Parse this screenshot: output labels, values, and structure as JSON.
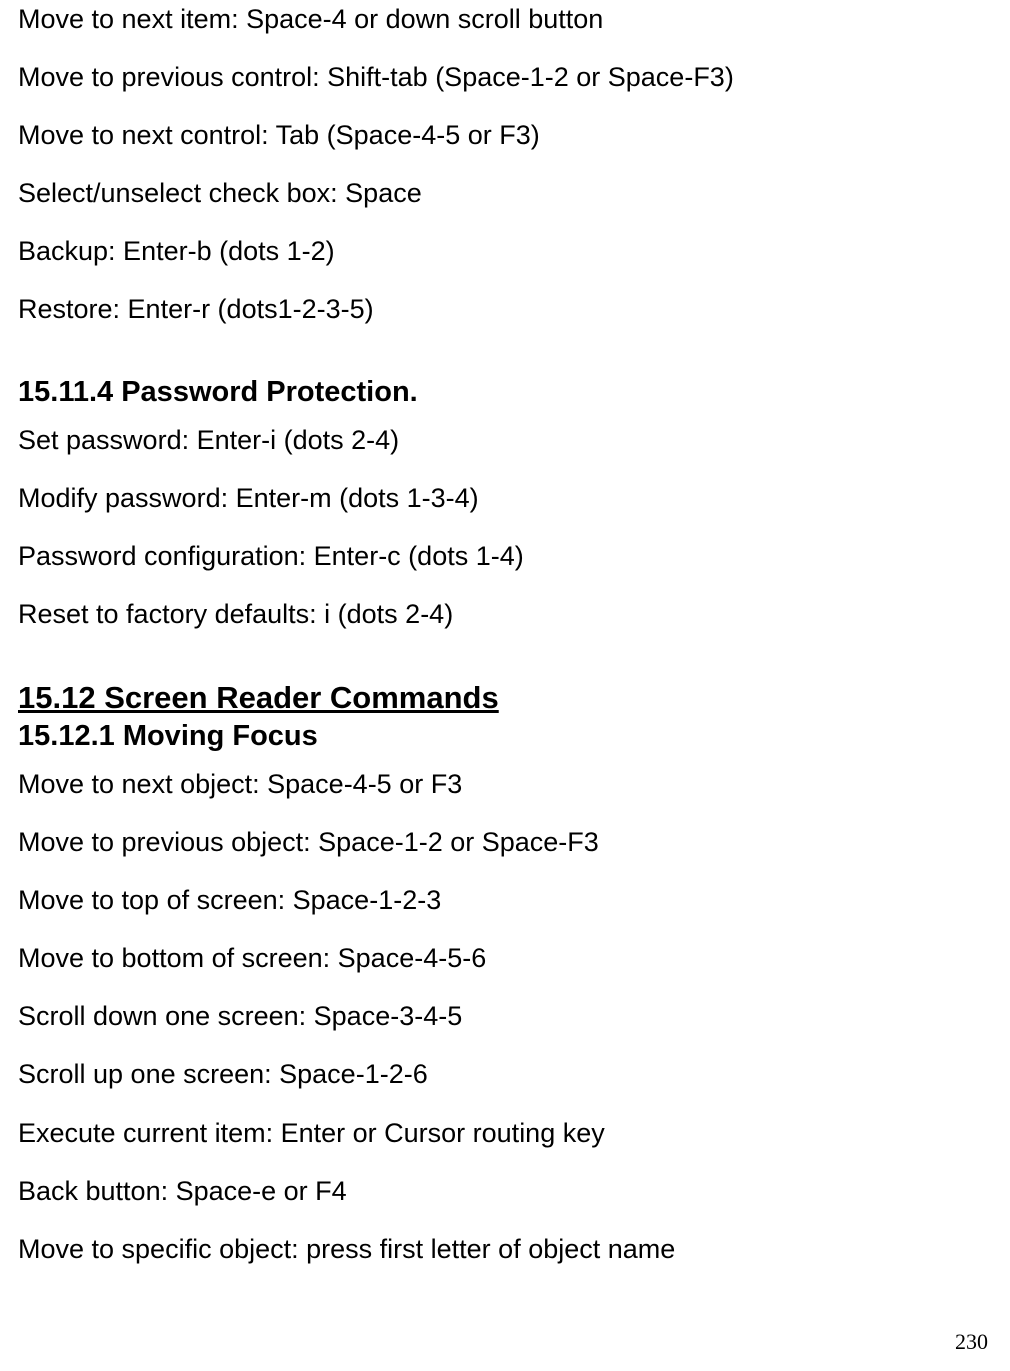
{
  "section1_lines": [
    "Move to next item: Space-4 or down scroll button",
    "Move to previous control: Shift-tab (Space-1-2 or Space-F3)",
    "Move to next control: Tab (Space-4-5 or F3)",
    "Select/unselect check box: Space",
    "Backup: Enter-b (dots 1-2)",
    "Restore: Enter-r (dots1-2-3-5)"
  ],
  "heading_password": "15.11.4 Password Protection.",
  "section2_lines": [
    "Set password: Enter-i (dots 2-4)",
    "Modify password: Enter-m (dots 1-3-4)",
    "Password configuration: Enter-c (dots 1-4)",
    "Reset to factory defaults: i (dots 2-4)"
  ],
  "heading_screen_reader": "15.12 Screen Reader Commands",
  "heading_moving_focus": "15.12.1 Moving Focus",
  "section3_lines": [
    "Move to next object: Space-4-5 or F3",
    "Move to previous object: Space-1-2 or Space-F3",
    "Move to top of screen: Space-1-2-3",
    "Move to bottom of screen: Space-4-5-6",
    "Scroll down one screen: Space-3-4-5",
    "Scroll up one screen: Space-1-2-6",
    "Execute current item: Enter or Cursor routing key",
    "Back button: Space-e or F4",
    "Move to specific object: press first letter of object name"
  ],
  "page_number": "230"
}
